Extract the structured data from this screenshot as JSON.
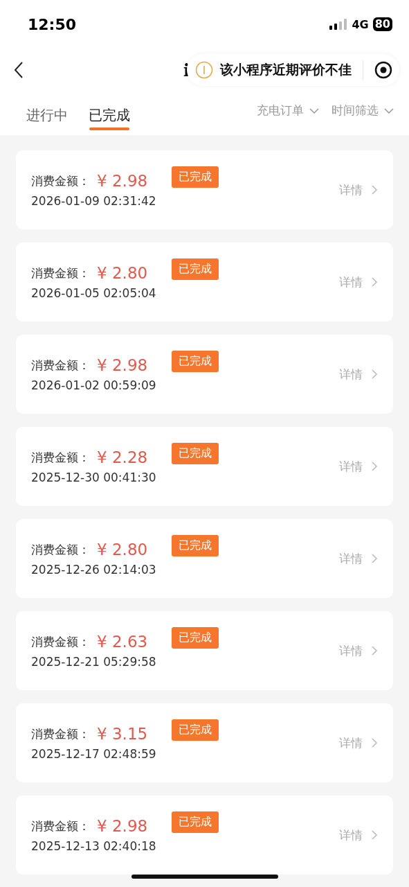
{
  "status_bar": {
    "time": "12:50",
    "network": "4G",
    "battery": "80"
  },
  "nav": {
    "title_fragment": "i",
    "notice": "该小程序近期评价不佳"
  },
  "tabs": [
    {
      "label": "进行中",
      "selected": false
    },
    {
      "label": "已完成",
      "selected": true
    }
  ],
  "filters": [
    {
      "label": "充电订单"
    },
    {
      "label": "时间筛选"
    }
  ],
  "orders": [
    {
      "label": "消费金额：",
      "currency": "¥",
      "amount": "2.98",
      "status": "已完成",
      "time": "2026-01-09 02:31:42",
      "detail": "详情"
    },
    {
      "label": "消费金额：",
      "currency": "¥",
      "amount": "2.80",
      "status": "已完成",
      "time": "2026-01-05 02:05:04",
      "detail": "详情"
    },
    {
      "label": "消费金额：",
      "currency": "¥",
      "amount": "2.98",
      "status": "已完成",
      "time": "2026-01-02 00:59:09",
      "detail": "详情"
    },
    {
      "label": "消费金额：",
      "currency": "¥",
      "amount": "2.28",
      "status": "已完成",
      "time": "2025-12-30 00:41:30",
      "detail": "详情"
    },
    {
      "label": "消费金额：",
      "currency": "¥",
      "amount": "2.80",
      "status": "已完成",
      "time": "2025-12-26 02:14:03",
      "detail": "详情"
    },
    {
      "label": "消费金额：",
      "currency": "¥",
      "amount": "2.63",
      "status": "已完成",
      "time": "2025-12-21 05:29:58",
      "detail": "详情"
    },
    {
      "label": "消费金额：",
      "currency": "¥",
      "amount": "3.15",
      "status": "已完成",
      "time": "2025-12-17 02:48:59",
      "detail": "详情"
    },
    {
      "label": "消费金额：",
      "currency": "¥",
      "amount": "2.98",
      "status": "已完成",
      "time": "2025-12-13 02:40:18",
      "detail": "详情"
    }
  ]
}
